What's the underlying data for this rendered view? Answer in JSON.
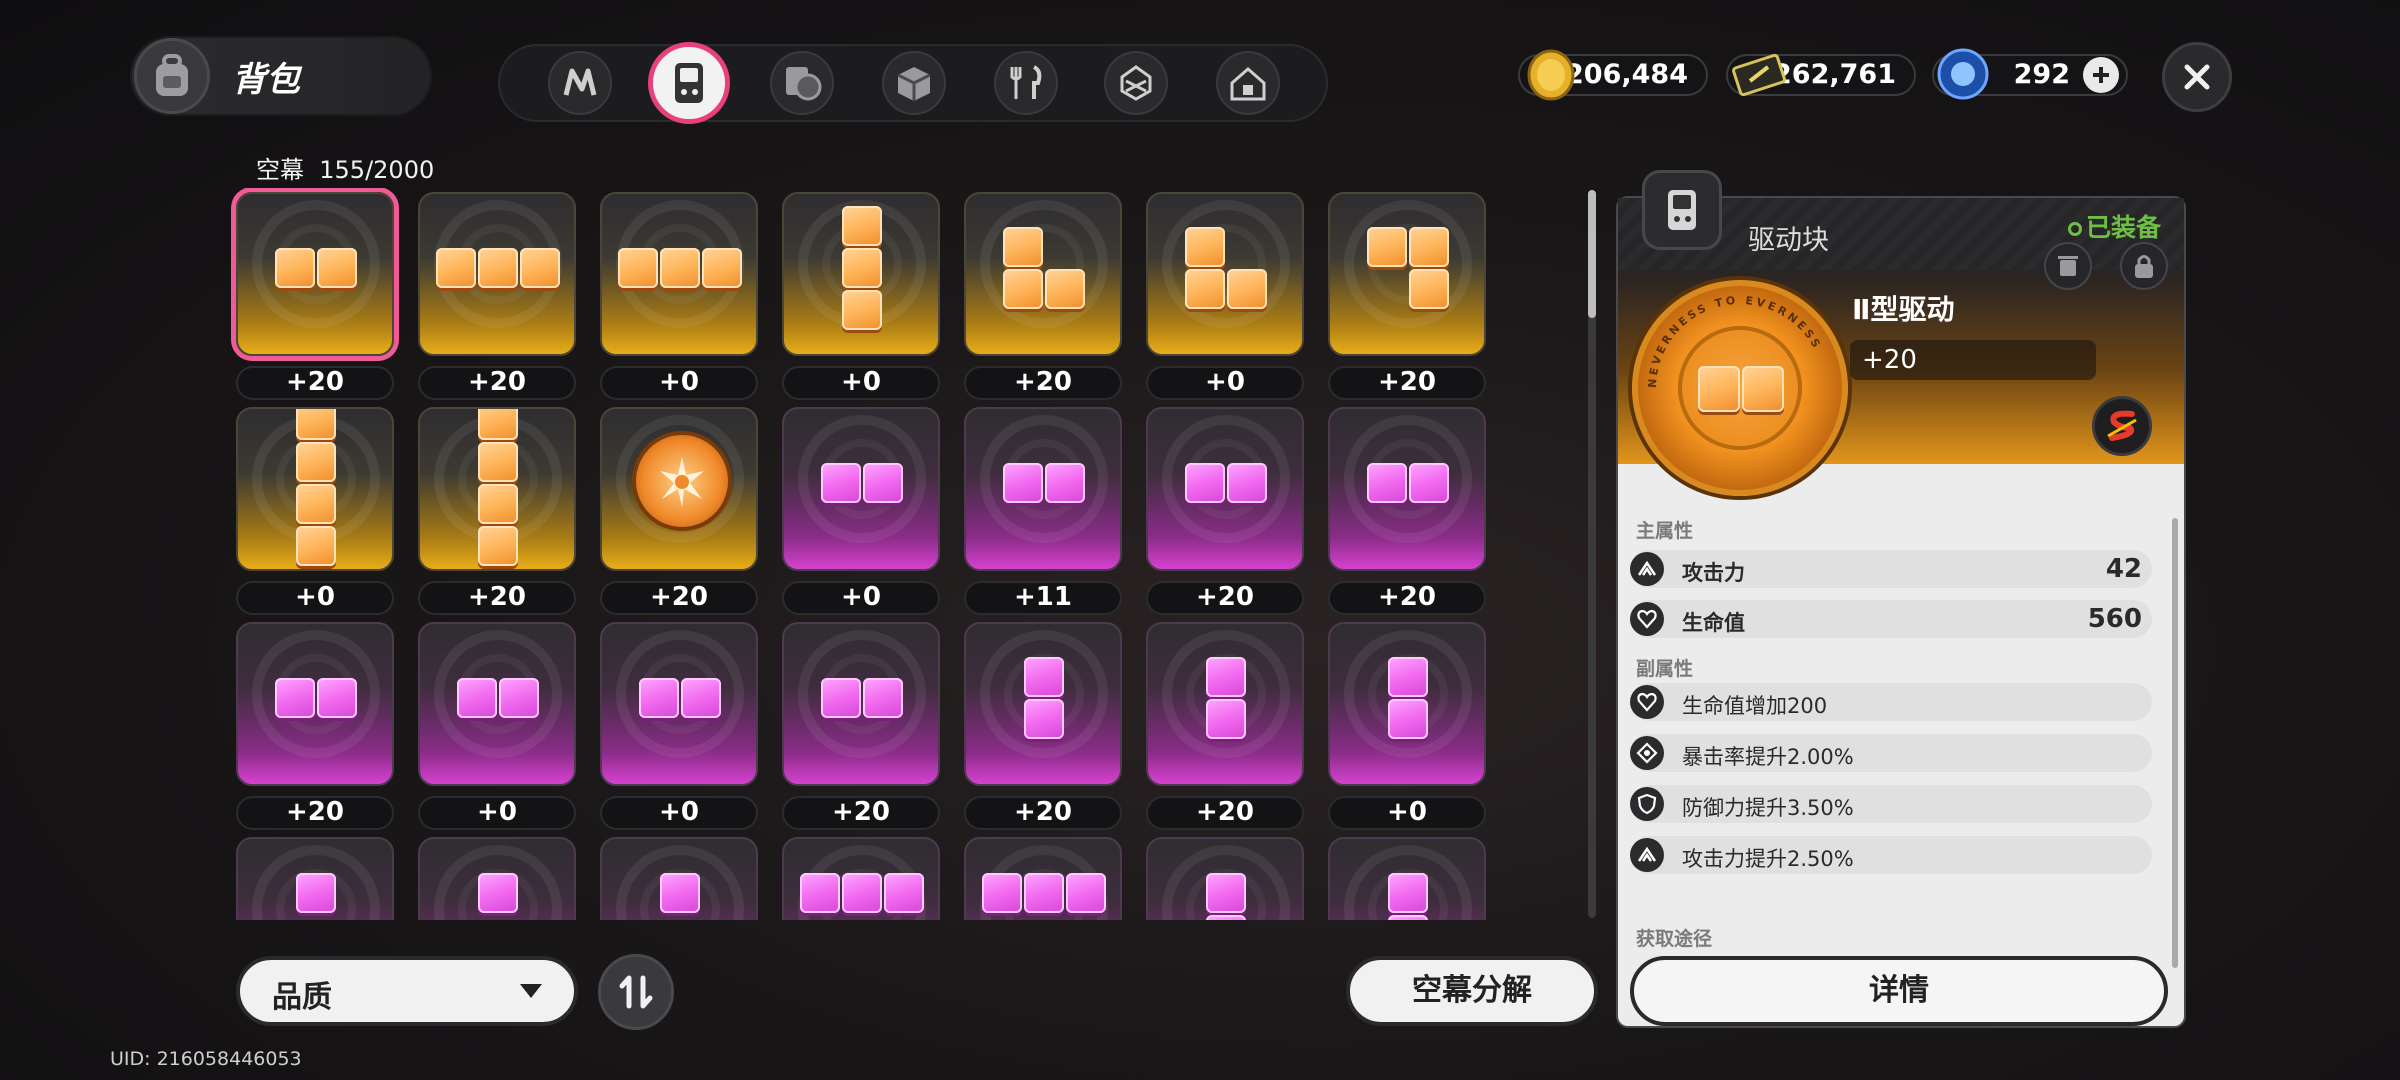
{
  "header": {
    "title": "背包",
    "tabs": [
      "tab-index-icon",
      "tab-device-icon",
      "tab-disc-icon",
      "tab-box-icon",
      "tab-food-icon",
      "tab-cube-icon",
      "tab-home-icon"
    ],
    "active_tab": 1
  },
  "currencies": [
    {
      "name": "gold-coin",
      "value": "206,484"
    },
    {
      "name": "ticket",
      "value": "262,761"
    },
    {
      "name": "crystal",
      "value": "292"
    }
  ],
  "inventory": {
    "capacity_label": "空幕",
    "capacity": "155/2000",
    "levels": [
      [
        "+20",
        "+20",
        "+0",
        "+0",
        "+20",
        "+0",
        "+20"
      ],
      [
        "+0",
        "+20",
        "+20",
        "+0",
        "+11",
        "+20",
        "+20"
      ],
      [
        "+20",
        "+0",
        "+0",
        "+20",
        "+20",
        "+20",
        "+0"
      ]
    ]
  },
  "bottom": {
    "quality_filter": "品质",
    "decompose": "空幕分解",
    "uid": "UID: 216058446053"
  },
  "detail": {
    "slot_title": "驱动块",
    "equipped": "已装备",
    "item_name": "Ⅱ型驱动",
    "item_level": "+20",
    "disc_text": "NEVERNESS TO EVERNESS",
    "main_attr_title": "主属性",
    "main_attrs": [
      {
        "name": "攻击力",
        "value": "42"
      },
      {
        "name": "生命值",
        "value": "560"
      }
    ],
    "sub_attr_title": "副属性",
    "sub_attrs": [
      {
        "name": "生命值增加200"
      },
      {
        "name": "暴击率提升2.00%"
      },
      {
        "name": "防御力提升3.50%"
      },
      {
        "name": "攻击力提升2.50%"
      }
    ],
    "source_title": "获取途径",
    "details_button": "详情"
  },
  "colors": {
    "accent_pink": "#e8407a",
    "gold_rarity": "#e8ad18",
    "purple_rarity": "#d641d0",
    "equipped_green": "#6fbf43"
  }
}
